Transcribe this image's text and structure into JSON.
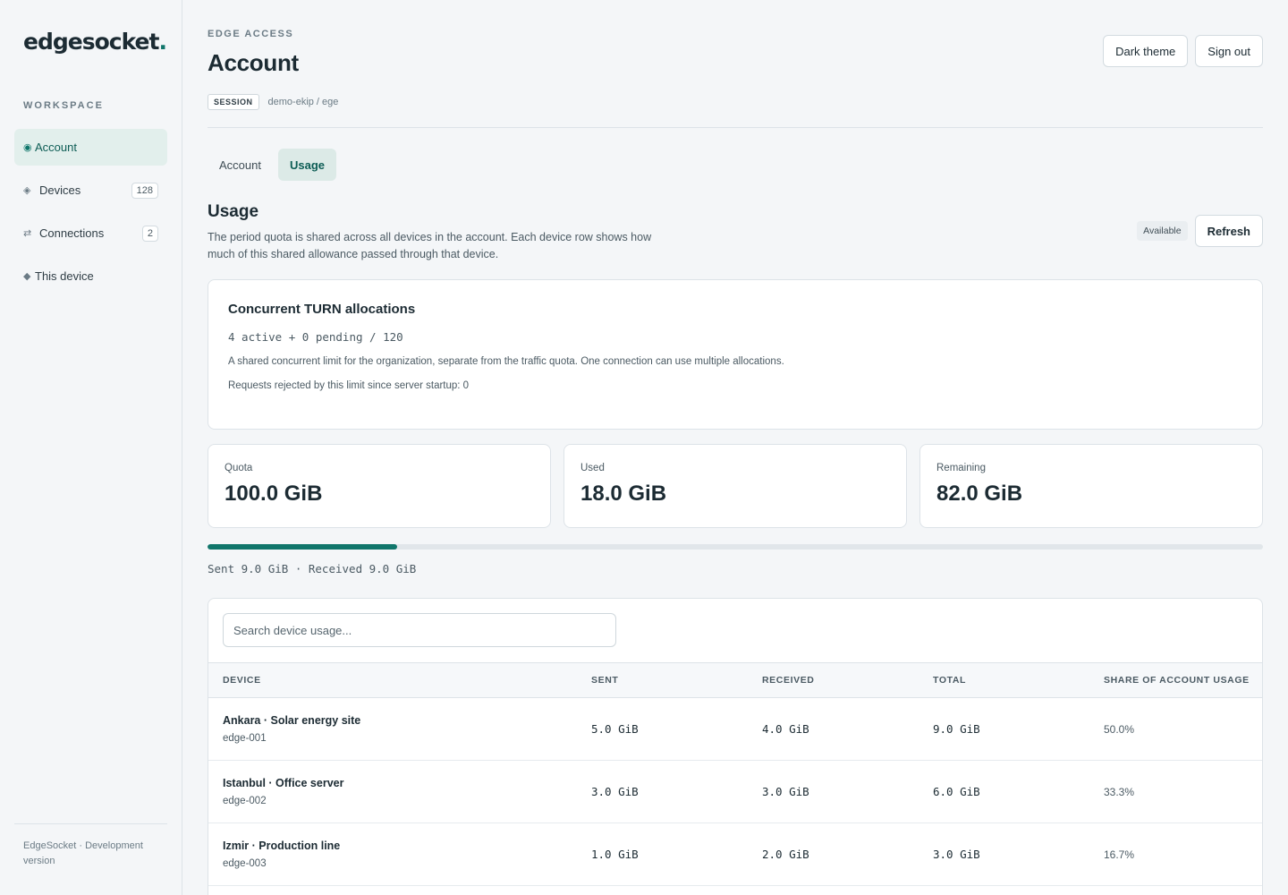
{
  "brand": {
    "name": "edgesocket",
    "dot": "."
  },
  "sidebar": {
    "section_label": "WORKSPACE",
    "items": [
      {
        "icon": "◉",
        "label": "Account",
        "badge": ""
      },
      {
        "icon": "◈",
        "label": "Devices",
        "badge": "128"
      },
      {
        "icon": "⇄",
        "label": "Connections",
        "badge": "2"
      },
      {
        "icon": "◆",
        "label": "This device",
        "badge": ""
      }
    ],
    "footer": "EdgeSocket · Development version"
  },
  "header": {
    "eyebrow": "EDGE ACCESS",
    "title": "Account",
    "session_tag": "SESSION",
    "session_value": "demo-ekip / ege",
    "dark_theme_label": "Dark theme",
    "sign_out_label": "Sign out"
  },
  "tabs": [
    {
      "label": "Account"
    },
    {
      "label": "Usage"
    }
  ],
  "usage": {
    "title": "Usage",
    "description": "The period quota is shared across all devices in the account. Each device row shows how much of this shared allowance passed through that device.",
    "status_badge": "Available",
    "refresh_label": "Refresh",
    "turn": {
      "title": "Concurrent TURN allocations",
      "count": "4 active + 0 pending / 120",
      "note": "A shared concurrent limit for the organization, separate from the traffic quota. One connection can use multiple allocations.",
      "rejected": "Requests rejected by this limit since server startup: 0"
    },
    "stats": [
      {
        "label": "Quota",
        "value": "100.0 GiB"
      },
      {
        "label": "Used",
        "value": "18.0 GiB"
      },
      {
        "label": "Remaining",
        "value": "82.0 GiB"
      }
    ],
    "used_fraction": 0.18,
    "traffic": "Sent 9.0 GiB · Received 9.0 GiB",
    "search_placeholder": "Search device usage...",
    "columns": [
      "DEVICE",
      "SENT",
      "RECEIVED",
      "TOTAL",
      "SHARE OF ACCOUNT USAGE"
    ],
    "rows": [
      {
        "name": "Ankara · Solar energy site",
        "id": "edge-001",
        "sent": "5.0 GiB",
        "received": "4.0 GiB",
        "total": "9.0 GiB",
        "share": "50.0%"
      },
      {
        "name": "Istanbul · Office server",
        "id": "edge-002",
        "sent": "3.0 GiB",
        "received": "3.0 GiB",
        "total": "6.0 GiB",
        "share": "33.3%"
      },
      {
        "name": "Izmir · Production line",
        "id": "edge-003",
        "sent": "1.0 GiB",
        "received": "2.0 GiB",
        "total": "3.0 GiB",
        "share": "16.7%"
      }
    ]
  },
  "colors": {
    "accent": "#10766b",
    "accent_soft": "#dceae7"
  }
}
